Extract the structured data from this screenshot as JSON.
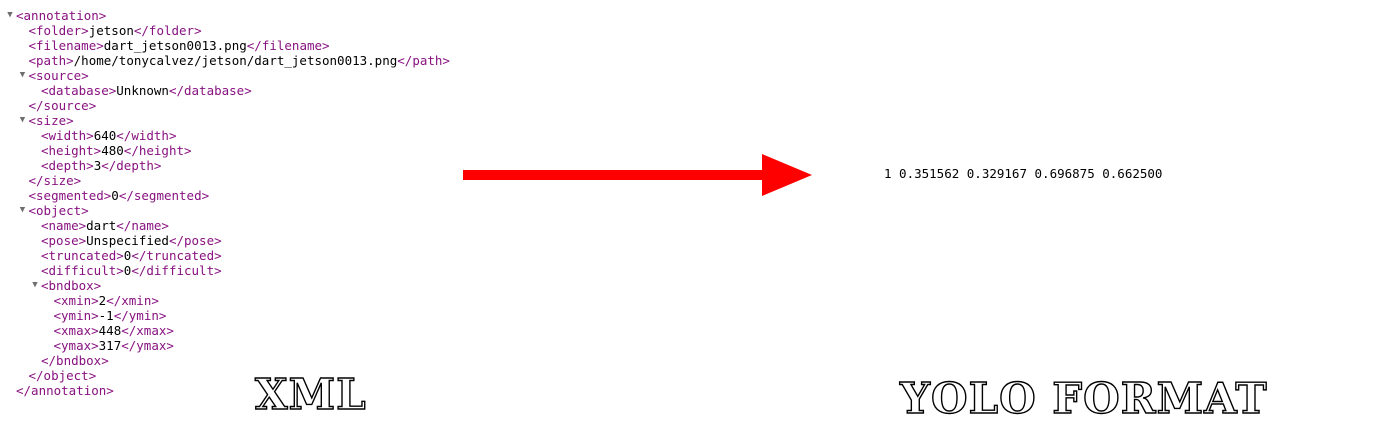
{
  "toggle_glyph": "▼",
  "xml_tree": {
    "lines": [
      {
        "indent": 0,
        "toggle": true,
        "open": "<annotation>",
        "text": "",
        "close": ""
      },
      {
        "indent": 1,
        "toggle": false,
        "open": "<folder>",
        "text": "jetson",
        "close": "</folder>"
      },
      {
        "indent": 1,
        "toggle": false,
        "open": "<filename>",
        "text": "dart_jetson0013.png",
        "close": "</filename>"
      },
      {
        "indent": 1,
        "toggle": false,
        "open": "<path>",
        "text": "/home/tonycalvez/jetson/dart_jetson0013.png",
        "close": "</path>"
      },
      {
        "indent": 1,
        "toggle": true,
        "open": "<source>",
        "text": "",
        "close": ""
      },
      {
        "indent": 2,
        "toggle": false,
        "open": "<database>",
        "text": "Unknown",
        "close": "</database>"
      },
      {
        "indent": 1,
        "toggle": false,
        "open": "",
        "text": "",
        "close": "</source>"
      },
      {
        "indent": 1,
        "toggle": true,
        "open": "<size>",
        "text": "",
        "close": ""
      },
      {
        "indent": 2,
        "toggle": false,
        "open": "<width>",
        "text": "640",
        "close": "</width>"
      },
      {
        "indent": 2,
        "toggle": false,
        "open": "<height>",
        "text": "480",
        "close": "</height>"
      },
      {
        "indent": 2,
        "toggle": false,
        "open": "<depth>",
        "text": "3",
        "close": "</depth>"
      },
      {
        "indent": 1,
        "toggle": false,
        "open": "",
        "text": "",
        "close": "</size>"
      },
      {
        "indent": 1,
        "toggle": false,
        "open": "<segmented>",
        "text": "0",
        "close": "</segmented>"
      },
      {
        "indent": 1,
        "toggle": true,
        "open": "<object>",
        "text": "",
        "close": ""
      },
      {
        "indent": 2,
        "toggle": false,
        "open": "<name>",
        "text": "dart",
        "close": "</name>"
      },
      {
        "indent": 2,
        "toggle": false,
        "open": "<pose>",
        "text": "Unspecified",
        "close": "</pose>"
      },
      {
        "indent": 2,
        "toggle": false,
        "open": "<truncated>",
        "text": "0",
        "close": "</truncated>"
      },
      {
        "indent": 2,
        "toggle": false,
        "open": "<difficult>",
        "text": "0",
        "close": "</difficult>"
      },
      {
        "indent": 2,
        "toggle": true,
        "open": "<bndbox>",
        "text": "",
        "close": ""
      },
      {
        "indent": 3,
        "toggle": false,
        "open": "<xmin>",
        "text": "2",
        "close": "</xmin>"
      },
      {
        "indent": 3,
        "toggle": false,
        "open": "<ymin>",
        "text": "-1",
        "close": "</ymin>"
      },
      {
        "indent": 3,
        "toggle": false,
        "open": "<xmax>",
        "text": "448",
        "close": "</xmax>"
      },
      {
        "indent": 3,
        "toggle": false,
        "open": "<ymax>",
        "text": "317",
        "close": "</ymax>"
      },
      {
        "indent": 2,
        "toggle": false,
        "open": "",
        "text": "",
        "close": "</bndbox>"
      },
      {
        "indent": 1,
        "toggle": false,
        "open": "",
        "text": "",
        "close": "</object>"
      },
      {
        "indent": 0,
        "toggle": false,
        "open": "",
        "text": "",
        "close": "</annotation>"
      }
    ]
  },
  "yolo": {
    "line": "1 0.351562 0.329167 0.696875 0.662500"
  },
  "labels": {
    "xml": "XML",
    "yolo": "YOLO FORMAT"
  },
  "colors": {
    "tag": "#881280",
    "text": "#000000",
    "arrow": "#ff0000"
  }
}
